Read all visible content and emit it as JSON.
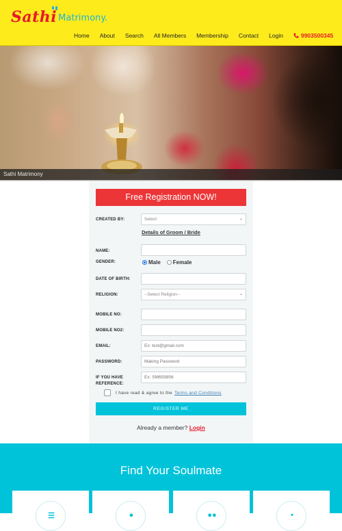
{
  "brand": {
    "name_primary": "Sathi",
    "name_secondary": "Matrimony."
  },
  "nav": {
    "items": [
      "Home",
      "About",
      "Search",
      "All Members",
      "Membership",
      "Contact",
      "Login"
    ],
    "phone": "9903500345",
    "phone_icon": "phone-icon"
  },
  "hero": {
    "caption": "Sathi Matrimony"
  },
  "form": {
    "title": "Free Registration NOW!",
    "created_by": {
      "label": "CREATED BY:",
      "value": "Select"
    },
    "section_heading": "Details of Groom / Bride",
    "name": {
      "label": "NAME:",
      "value": ""
    },
    "gender": {
      "label": "GENDER:",
      "options": [
        "Male",
        "Female"
      ],
      "selected": "Male"
    },
    "dob": {
      "label": "DATE OF BIRTH:",
      "value": ""
    },
    "religion": {
      "label": "RELIGION:",
      "value": "--Select Religion--"
    },
    "mobile": {
      "label": "MOBILE NO:",
      "value": ""
    },
    "mobile2": {
      "label": "MOBILE NO2:",
      "value": ""
    },
    "email": {
      "label": "EMAIL:",
      "placeholder": "Ex: test@gmail.com"
    },
    "password": {
      "label": "PASSWORD:",
      "placeholder": "Making Password"
    },
    "reference": {
      "label_line1": "IF YOU HAVE",
      "label_line2": "REFERENCE:",
      "placeholder": "Ex: SM659856"
    },
    "agree": {
      "text": "I have read & agree to the",
      "link": "Terms and Conditions",
      "checked": false
    },
    "submit": "REGISTER ME",
    "already": {
      "text": "Already a member?",
      "link": "Login"
    }
  },
  "soulmate": {
    "title": "Find Your Soulmate",
    "cards": [
      {
        "icon": "register-icon",
        "glyph": "☰"
      },
      {
        "icon": "profile-icon",
        "glyph": "●"
      },
      {
        "icon": "couple-icon",
        "glyph": "●●"
      },
      {
        "icon": "connect-icon",
        "glyph": "•"
      }
    ]
  },
  "colors": {
    "header_bg": "#fdeb1c",
    "brand_red": "#e8192c",
    "brand_cyan": "#00c3da",
    "form_title_bg": "#ec3537",
    "link_blue": "#3a7fb5"
  }
}
